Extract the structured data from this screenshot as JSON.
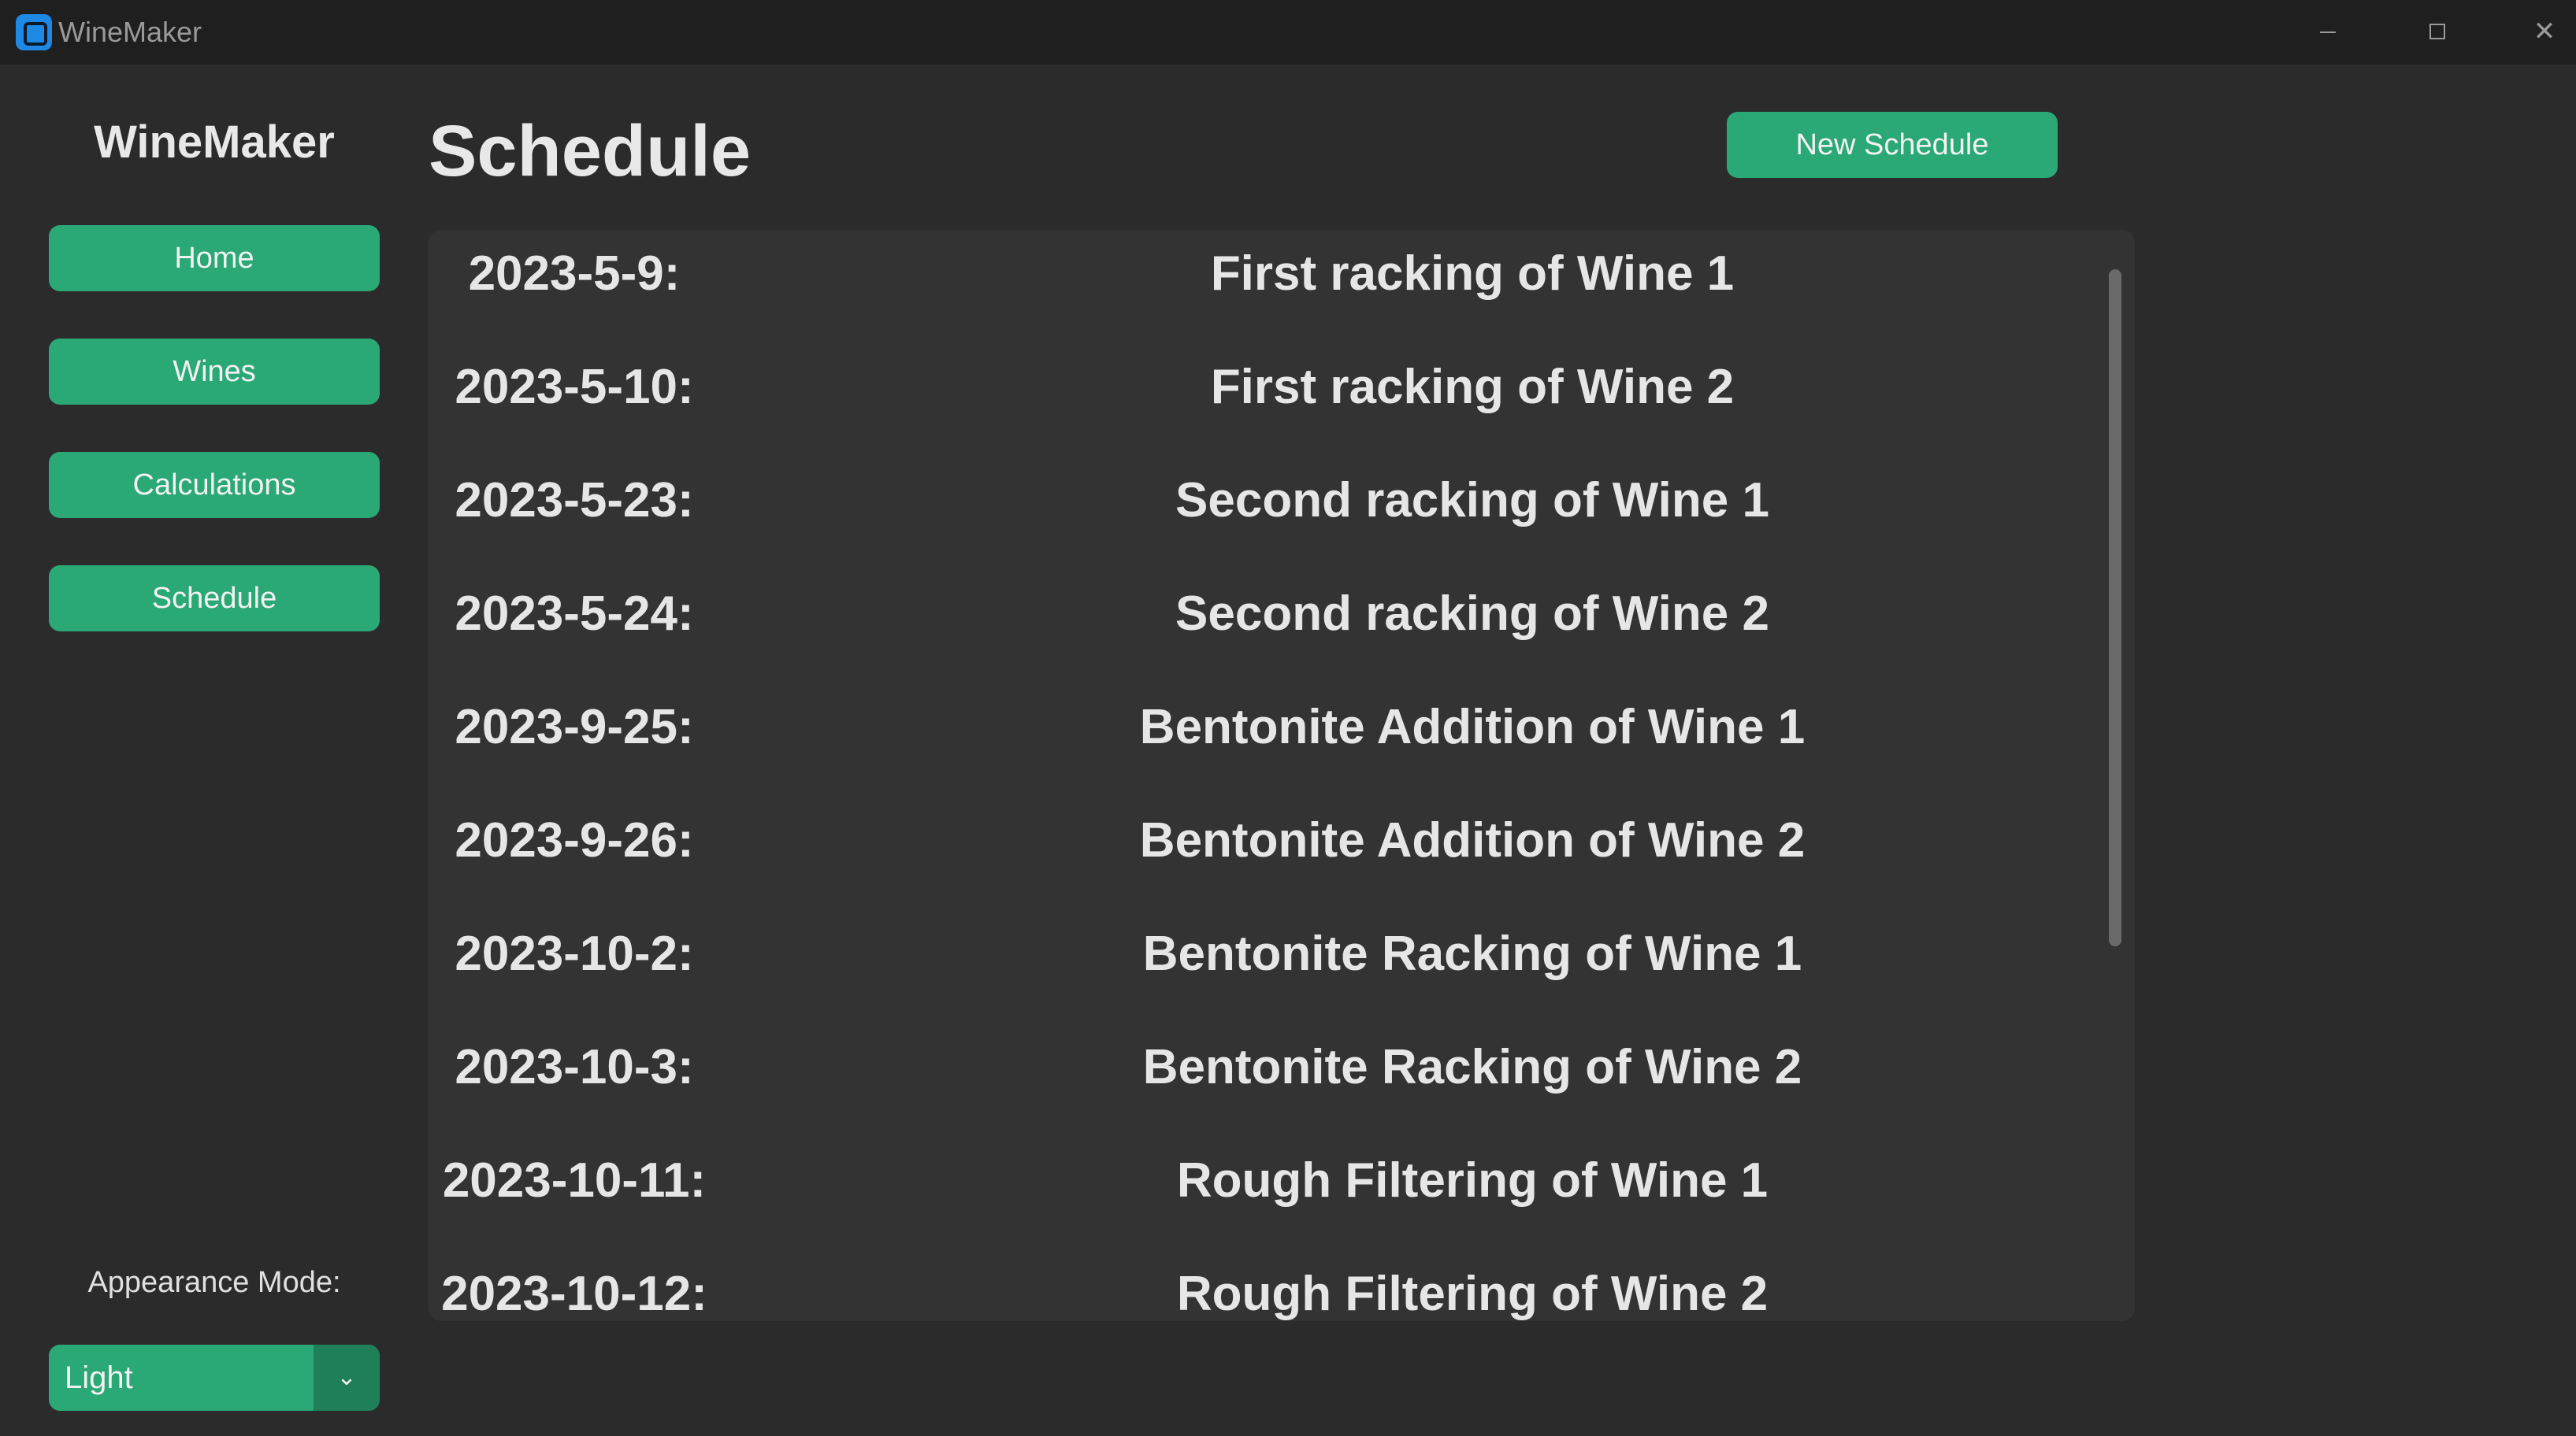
{
  "window": {
    "title": "WineMaker",
    "controls": {
      "minimize": "—",
      "maximize": "☐",
      "close": "✕"
    }
  },
  "sidebar": {
    "logo": "WineMaker",
    "nav": [
      {
        "label": "Home"
      },
      {
        "label": "Wines"
      },
      {
        "label": "Calculations"
      },
      {
        "label": "Schedule"
      }
    ],
    "appearance_label": "Appearance Mode:",
    "appearance_value": "Light",
    "appearance_arrow": "⌄"
  },
  "main": {
    "title": "Schedule",
    "new_button": "New Schedule",
    "schedule": [
      {
        "date": "2023-5-9:",
        "task": "First racking of Wine 1"
      },
      {
        "date": "2023-5-10:",
        "task": "First racking of Wine 2"
      },
      {
        "date": "2023-5-23:",
        "task": "Second racking of Wine 1"
      },
      {
        "date": "2023-5-24:",
        "task": "Second racking of Wine 2"
      },
      {
        "date": "2023-9-25:",
        "task": "Bentonite Addition of Wine 1"
      },
      {
        "date": "2023-9-26:",
        "task": "Bentonite Addition of Wine 2"
      },
      {
        "date": "2023-10-2:",
        "task": "Bentonite Racking of Wine 1"
      },
      {
        "date": "2023-10-3:",
        "task": "Bentonite Racking of Wine 2"
      },
      {
        "date": "2023-10-11:",
        "task": "Rough Filtering of Wine 1"
      },
      {
        "date": "2023-10-12:",
        "task": "Rough Filtering of Wine 2"
      }
    ]
  },
  "colors": {
    "accent": "#2aa876",
    "accent_dark": "#1f7f59",
    "background": "#2b2b2b",
    "panel": "#333333",
    "titlebar": "#1f1f1f"
  }
}
